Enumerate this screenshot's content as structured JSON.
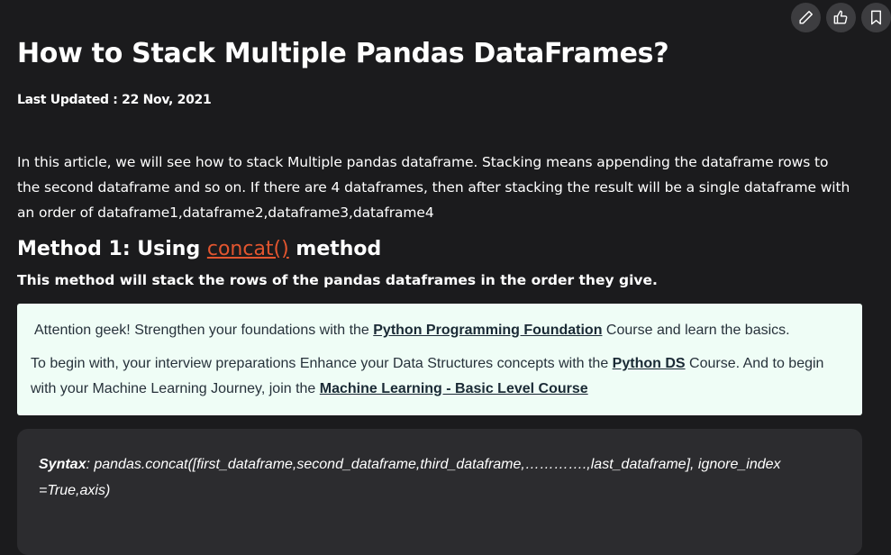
{
  "toolbar": {
    "icons": [
      "pencil-icon",
      "thumbs-up-icon",
      "bookmark-icon"
    ]
  },
  "article": {
    "title": "How to Stack Multiple Pandas DataFrames?",
    "last_updated": "Last Updated : 22 Nov, 2021",
    "intro": "In this article, we will see how to stack Multiple pandas dataframe. Stacking means appending the dataframe rows to the second dataframe and so on. If there are 4 dataframes, then after stacking the result will be a single dataframe with an order of dataframe1,dataframe2,dataframe3,dataframe4",
    "method_prefix": "Method 1: Using ",
    "method_link": "concat()",
    "method_suffix": " method",
    "method_desc": "This method will stack the rows of the pandas dataframes in the order they give."
  },
  "attention": {
    "line1_pre": "Attention geek! Strengthen your foundations with the ",
    "line1_link": "Python Programming Foundation",
    "line1_post": " Course and learn the basics.",
    "line2_pre": "To begin with, your interview preparations Enhance your Data Structures concepts with the ",
    "line2_link": "Python DS",
    "line2_mid": " Course. And to begin with your Machine Learning Journey, join the ",
    "line2_link2": "Machine Learning - Basic Level Course"
  },
  "syntax": {
    "label": "Syntax",
    "text": ": pandas.concat([first_dataframe,second_dataframe,third_dataframe,………….,last_dataframe], ignore_index =True,axis)"
  },
  "colors": {
    "background": "#1b1b1d",
    "link_orange": "#e2552f",
    "attention_bg": "#effdf6",
    "code_bg": "#2c2c2f"
  }
}
